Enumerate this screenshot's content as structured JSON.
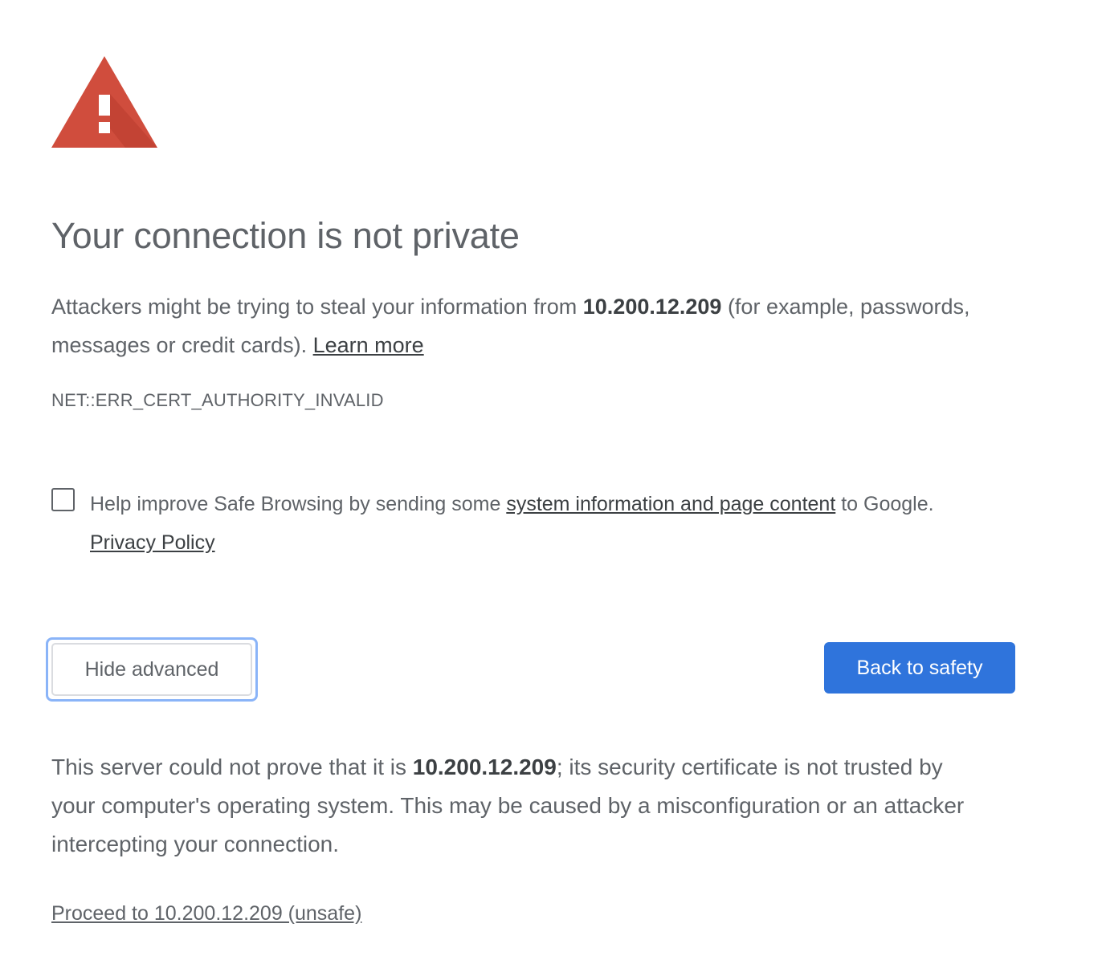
{
  "colors": {
    "warning_red": "#d04d3d",
    "primary_blue": "#2f74dc",
    "text_gray": "#5f6368",
    "focus_ring": "#8ab4f8"
  },
  "icon": "warning-triangle-icon",
  "title": "Your connection is not private",
  "explanation": {
    "text_before": "Attackers might be trying to steal your information from ",
    "host": "10.200.12.209",
    "text_after": " (for example, passwords, messages or credit cards). ",
    "learn_more": "Learn more"
  },
  "error_code": "NET::ERR_CERT_AUTHORITY_INVALID",
  "optin": {
    "checked": false,
    "text_before": "Help improve Safe Browsing by sending some ",
    "link": "system information and page content",
    "text_after": " to Google.",
    "privacy_policy": "Privacy Policy"
  },
  "buttons": {
    "hide_advanced": "Hide advanced",
    "back_to_safety": "Back to safety"
  },
  "details": {
    "text_before": "This server could not prove that it is ",
    "host": "10.200.12.209",
    "text_after": "; its security certificate is not trusted by your computer's operating system. This may be caused by a misconfiguration or an attacker intercepting your connection."
  },
  "proceed_link": "Proceed to 10.200.12.209 (unsafe)"
}
